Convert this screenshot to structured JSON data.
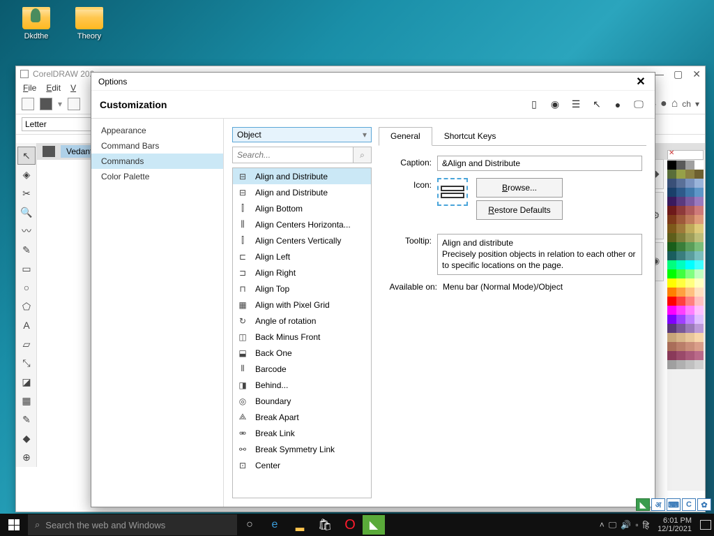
{
  "desktop": {
    "icons": [
      {
        "label": "Dkdthe"
      },
      {
        "label": "Theory"
      }
    ]
  },
  "corel": {
    "title": "CorelDRAW 202...",
    "menu": [
      "File",
      "Edit",
      "V"
    ],
    "paper": "Letter",
    "home_tab": "Vedant",
    "snap": "ch",
    "right_tabs": [
      "Hints",
      "Properties",
      "Objects"
    ]
  },
  "dialog": {
    "title": "Options",
    "heading": "Customization",
    "categories": [
      "Appearance",
      "Command Bars",
      "Commands",
      "Color Palette"
    ],
    "selected_category": "Commands",
    "filter": "Object",
    "search_placeholder": "Search...",
    "commands": [
      "Align and Distribute",
      "Align and Distribute",
      "Align Bottom",
      "Align Centers Horizonta...",
      "Align Centers Vertically",
      "Align Left",
      "Align Right",
      "Align Top",
      "Align with Pixel Grid",
      "Angle of rotation",
      "Back Minus Front",
      "Back One",
      "Barcode",
      "Behind...",
      "Boundary",
      "Break Apart",
      "Break Link",
      "Break Symmetry Link",
      "Center"
    ],
    "selected_command_index": 0,
    "tabs": [
      "General",
      "Shortcut Keys"
    ],
    "active_tab": "General",
    "detail": {
      "caption_label": "Caption:",
      "caption_value": "&Align and Distribute",
      "icon_label": "Icon:",
      "browse": "Browse...",
      "restore": "Restore Defaults",
      "tooltip_label": "Tooltip:",
      "tooltip_value": "Align and distribute\nPrecisely position objects in relation to each other or to specific locations on the page.",
      "available_label": "Available on:",
      "available_value": "Menu bar (Normal Mode)/Object"
    }
  },
  "taskbar": {
    "search": "Search the web and Windows",
    "time": "6:01 PM",
    "date": "12/1/2021",
    "lang": "हि"
  },
  "palette": [
    "#000000",
    "#5a5a5a",
    "#a0a0a0",
    "#ffffff",
    "#5a6e3a",
    "#96a048",
    "#8a8042",
    "#6e6030",
    "#3a5078",
    "#5a7098",
    "#7992be",
    "#9ab4da",
    "#1a406a",
    "#2e5a8a",
    "#4078aa",
    "#5e96c8",
    "#3a1a5e",
    "#5a3a7e",
    "#7a5a9e",
    "#9a7abe",
    "#6e1a1a",
    "#8e3a3a",
    "#ae5a5a",
    "#ce7a7a",
    "#7e3a1a",
    "#9e5a3a",
    "#be7a5a",
    "#de9a7a",
    "#7e5a1a",
    "#9e7a3a",
    "#beaa5a",
    "#deca7a",
    "#5e5e1a",
    "#7e7e3a",
    "#9e9e5a",
    "#bebe7a",
    "#1a5e1a",
    "#3a7e3a",
    "#5a9e5a",
    "#7abe7a",
    "#1a5e5e",
    "#3a7e7e",
    "#5a9e9e",
    "#7abebe",
    "#00ff7f",
    "#00ffbf",
    "#00ffff",
    "#40ffff",
    "#00ff00",
    "#40ff40",
    "#80ff80",
    "#c0ffc0",
    "#ffff00",
    "#ffff40",
    "#ffff80",
    "#ffffc0",
    "#ff8000",
    "#ffa040",
    "#ffc080",
    "#ffe0c0",
    "#ff0000",
    "#ff4040",
    "#ff8080",
    "#ffc0c0",
    "#ff00ff",
    "#ff40ff",
    "#ff80ff",
    "#ffc0ff",
    "#8000ff",
    "#a040ff",
    "#c080ff",
    "#e0c0ff",
    "#5a3a78",
    "#7a5a98",
    "#9a7ab8",
    "#bc9ad8",
    "#c8a67a",
    "#d8b68a",
    "#e8c69a",
    "#f8d6aa",
    "#aa6e5a",
    "#ba7e6a",
    "#ca8e7a",
    "#da9e8a",
    "#8a3a5a",
    "#9a4a6a",
    "#aa5a7a",
    "#ba6a8a",
    "#a0a0a0",
    "#b0b0b0",
    "#c0c0c0",
    "#d0d0d0"
  ]
}
